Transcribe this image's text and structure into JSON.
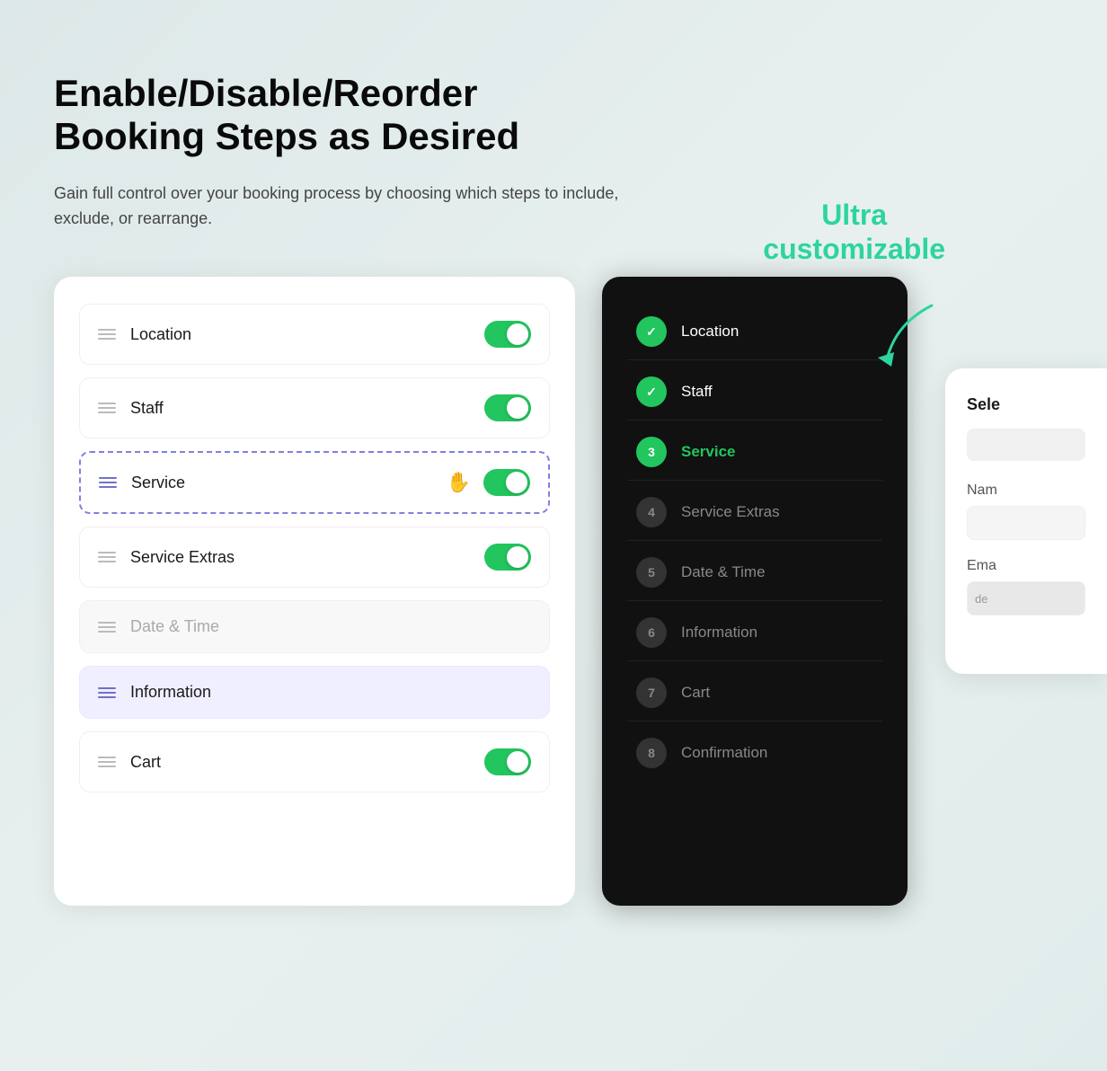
{
  "header": {
    "title_line1": "Enable/Disable/Reorder",
    "title_line2": "Booking Steps as Desired",
    "subtitle": "Gain full control over your booking process by choosing which steps to include, exclude, or rearrange.",
    "ultra_label_line1": "Ultra",
    "ultra_label_line2": "customizable"
  },
  "left_card": {
    "steps": [
      {
        "id": "location",
        "label": "Location",
        "enabled": true,
        "disabled": false,
        "dashed": false,
        "highlight": false
      },
      {
        "id": "staff",
        "label": "Staff",
        "enabled": true,
        "disabled": false,
        "dashed": false,
        "highlight": false
      },
      {
        "id": "service",
        "label": "Service",
        "enabled": true,
        "disabled": false,
        "dashed": true,
        "highlight": false
      },
      {
        "id": "service-extras",
        "label": "Service Extras",
        "enabled": true,
        "disabled": false,
        "dashed": false,
        "highlight": false
      },
      {
        "id": "date-time",
        "label": "Date & Time",
        "enabled": false,
        "disabled": true,
        "dashed": false,
        "highlight": false
      },
      {
        "id": "information",
        "label": "Information",
        "enabled": false,
        "disabled": false,
        "dashed": false,
        "highlight": true
      },
      {
        "id": "cart",
        "label": "Cart",
        "enabled": true,
        "disabled": false,
        "dashed": false,
        "highlight": false
      }
    ]
  },
  "right_card": {
    "steps": [
      {
        "number": "✓",
        "label": "Location",
        "state": "active"
      },
      {
        "number": "✓",
        "label": "Staff",
        "state": "active"
      },
      {
        "number": "3",
        "label": "Service",
        "state": "current"
      },
      {
        "number": "4",
        "label": "Service Extras",
        "state": "inactive"
      },
      {
        "number": "5",
        "label": "Date & Time",
        "state": "inactive"
      },
      {
        "number": "6",
        "label": "Information",
        "state": "inactive"
      },
      {
        "number": "7",
        "label": "Cart",
        "state": "inactive"
      },
      {
        "number": "8",
        "label": "Confirmation",
        "state": "inactive"
      }
    ]
  },
  "third_card": {
    "select_label": "Sele",
    "name_label": "Nam",
    "email_label": "Ema",
    "input_placeholder": "de"
  }
}
